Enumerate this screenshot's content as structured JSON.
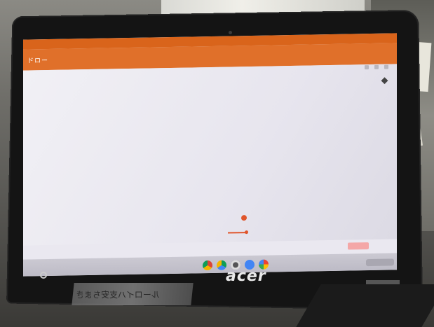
{
  "app": {
    "title": "ドロー"
  },
  "device": {
    "brand": "acer"
  },
  "reflection": {
    "text": "ルーロイハ支安ちまき"
  },
  "colors": {
    "appbar": "#e0702a",
    "statusbar": "#d9641b",
    "canvas": "#eae8f0",
    "accent_drawing": "#e0552b"
  },
  "icons": {
    "shelf": [
      "chrome-icon",
      "drive-icon",
      "camera-icon",
      "files-icon",
      "photos-icon"
    ],
    "toolbar": [
      "more-icon",
      "share-icon",
      "undo-icon"
    ]
  }
}
